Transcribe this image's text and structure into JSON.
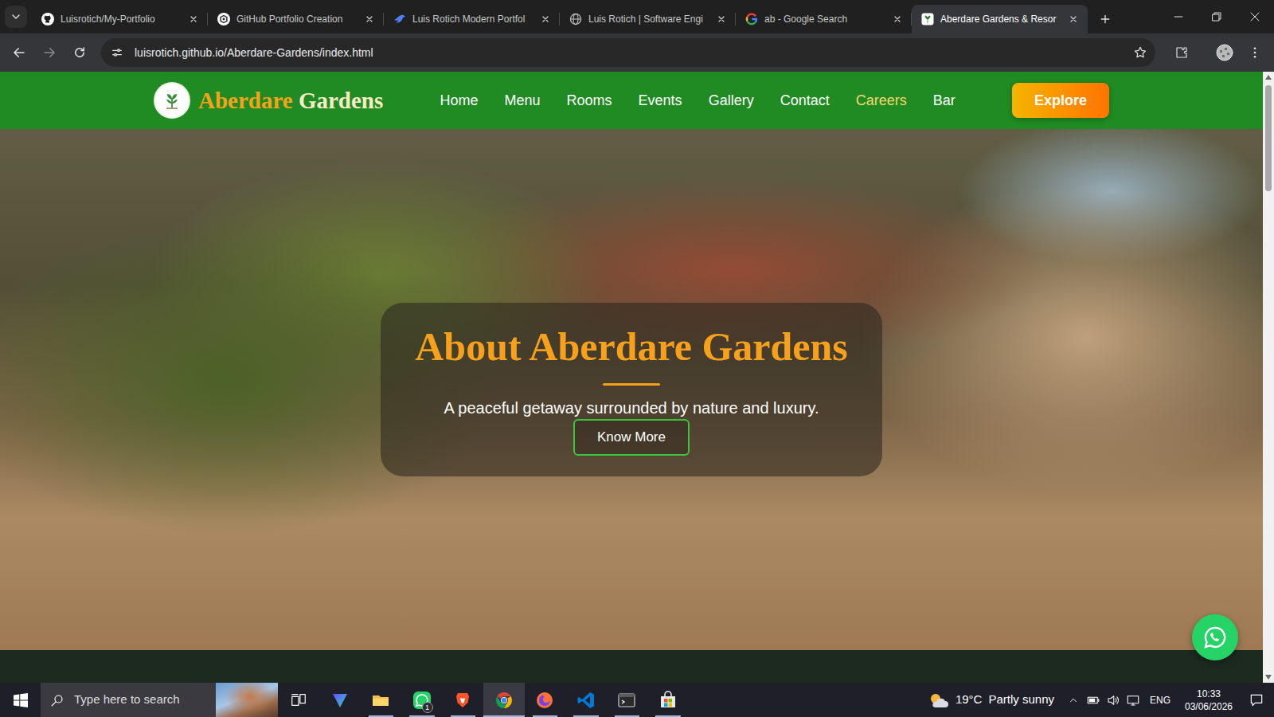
{
  "browser": {
    "tabs": [
      {
        "label": "Luisrotich/My-Portfolio",
        "kind": "github",
        "selected": false
      },
      {
        "label": "GitHub Portfolio Creation",
        "kind": "chatgpt",
        "selected": false
      },
      {
        "label": "Luis Rotich Modern Portfol",
        "kind": "bird",
        "selected": false
      },
      {
        "label": "Luis Rotich | Software Engi",
        "kind": "globe",
        "selected": false
      },
      {
        "label": "ab - Google Search",
        "kind": "google",
        "selected": false
      },
      {
        "label": "Aberdare Gardens & Resor",
        "kind": "site",
        "selected": true
      }
    ],
    "address": "luisrotich.github.io/Aberdare-Gardens/index.html"
  },
  "page": {
    "brand": {
      "first": "Aberdare",
      "second": "Gardens"
    },
    "nav": [
      {
        "label": "Home",
        "selected": false
      },
      {
        "label": "Menu",
        "selected": false
      },
      {
        "label": "Rooms",
        "selected": false
      },
      {
        "label": "Events",
        "selected": false
      },
      {
        "label": "Gallery",
        "selected": false
      },
      {
        "label": "Contact",
        "selected": false
      },
      {
        "label": "Careers",
        "selected": true
      },
      {
        "label": "Bar",
        "selected": false
      }
    ],
    "cta": "Explore",
    "hero": {
      "title": "About Aberdare Gardens",
      "subtitle": "A peaceful getaway surrounded by nature and luxury.",
      "button": "Know More"
    }
  },
  "taskbar": {
    "search": {
      "placeholder": "Type here to search"
    },
    "apps": [
      {
        "kind": "vpn",
        "running": false,
        "selected": false
      },
      {
        "kind": "explorer",
        "running": true,
        "selected": false
      },
      {
        "kind": "whatsapp",
        "running": true,
        "selected": false,
        "badge": "1"
      },
      {
        "kind": "brave",
        "running": true,
        "selected": false
      },
      {
        "kind": "chrome",
        "running": true,
        "selected": true
      },
      {
        "kind": "firefox",
        "running": true,
        "selected": false
      },
      {
        "kind": "vscode",
        "running": true,
        "selected": false
      },
      {
        "kind": "terminal",
        "running": true,
        "selected": false
      },
      {
        "kind": "store",
        "running": true,
        "selected": false
      }
    ],
    "weather": {
      "temperature": "19°C",
      "condition": "Partly sunny"
    },
    "language": "ENG",
    "time": "10:33",
    "date": "03/06/2026"
  }
}
